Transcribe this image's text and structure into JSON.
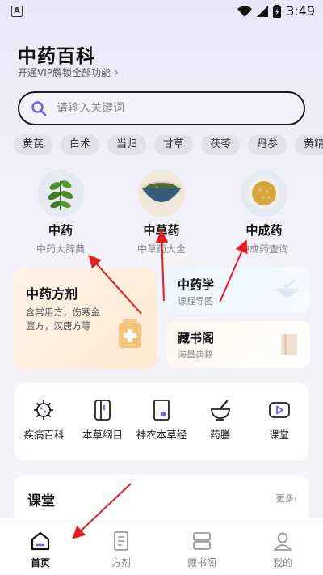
{
  "status_bar": {
    "app_glyph": "A",
    "time": "3:49"
  },
  "header": {
    "title": "中药百科",
    "vip_text": "开通VIP解锁全部功能",
    "vip_chevron": "›"
  },
  "search": {
    "placeholder": "请输入关键词"
  },
  "chips": [
    "黄芪",
    "白术",
    "当归",
    "甘草",
    "茯苓",
    "丹参",
    "黄精"
  ],
  "categories": [
    {
      "name": "中药",
      "sub": "中药大辞典",
      "icon": "herb-plant-icon"
    },
    {
      "name": "中草药",
      "sub": "中草药大全",
      "icon": "herb-bowl-icon"
    },
    {
      "name": "中成药",
      "sub": "中成药查询",
      "icon": "pill-seeds-icon"
    }
  ],
  "cards": {
    "fangji": {
      "title": "中药方剂",
      "desc": "含常用方，伤寒金匮方，汉唐方等"
    },
    "zhongyaoxue": {
      "title": "中药学",
      "desc": "课程导图"
    },
    "cangshu": {
      "title": "藏书阁",
      "desc": "海量典籍"
    }
  },
  "tools": [
    {
      "label": "疾病百科",
      "icon": "virus-icon"
    },
    {
      "label": "本草纲目",
      "icon": "book-icon"
    },
    {
      "label": "神农本草经",
      "icon": "classic-book-icon"
    },
    {
      "label": "药膳",
      "icon": "mortar-icon"
    },
    {
      "label": "课堂",
      "icon": "video-play-icon"
    }
  ],
  "classroom": {
    "title": "课堂",
    "more": "更多"
  },
  "tabbar": [
    {
      "label": "首页",
      "icon": "home-icon",
      "active": true
    },
    {
      "label": "方剂",
      "icon": "document-icon",
      "active": false
    },
    {
      "label": "藏书阁",
      "icon": "library-icon",
      "active": false
    },
    {
      "label": "我的",
      "icon": "profile-icon",
      "active": false
    }
  ],
  "colors": {
    "accent": "#7b5cf0",
    "arrow": "#e02020"
  }
}
